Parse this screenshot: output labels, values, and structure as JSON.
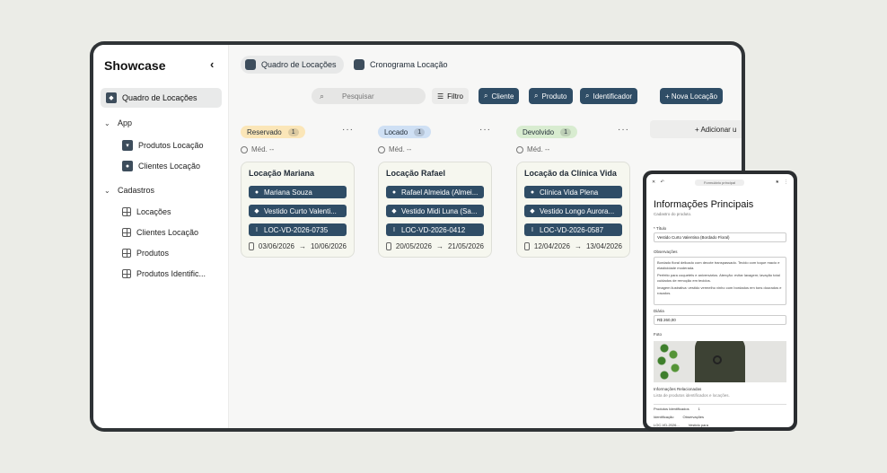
{
  "sidebar": {
    "title": "Showcase",
    "active_item": "Quadro de Locações",
    "groups": [
      {
        "label": "App",
        "items": [
          "Produtos Locação",
          "Clientes Locação"
        ]
      },
      {
        "label": "Cadastros",
        "items": [
          "Locações",
          "Clientes Locação",
          "Produtos",
          "Produtos Identific..."
        ]
      }
    ]
  },
  "tabs": [
    "Quadro de Locações",
    "Cronograma Locação"
  ],
  "toolbar": {
    "search_placeholder": "Pesquisar",
    "filter": "Filtro",
    "chips": [
      "Cliente",
      "Produto",
      "Identificador"
    ],
    "new": "+ Nova Locação"
  },
  "columns": [
    {
      "label": "Reservado",
      "count": "1",
      "color": "#fbe6b8",
      "med": "Méd. --",
      "card": {
        "title": "Locação Mariana",
        "client": "Mariana Souza",
        "product": "Vestido Curto Valenti...",
        "code": "LOC-VD-2026-0735",
        "start": "03/06/2026",
        "end": "10/06/2026"
      }
    },
    {
      "label": "Locado",
      "count": "1",
      "color": "#cfe0f4",
      "med": "Méd. --",
      "card": {
        "title": "Locação Rafael",
        "client": "Rafael Almeida (Almei...",
        "product": "Vestido Midi Luna (Sa...",
        "code": "LOC-VD-2026-0412",
        "start": "20/05/2026",
        "end": "21/05/2026"
      }
    },
    {
      "label": "Devolvido",
      "count": "1",
      "color": "#d8ecd0",
      "med": "Méd. --",
      "card": {
        "title": "Locação da Clínica Vida",
        "client": "Clínica Vida Plena",
        "product": "Vestido Longo Aurora...",
        "code": "LOC-VD-2026-0587",
        "start": "12/04/2026",
        "end": "13/04/2026"
      }
    }
  ],
  "add_column": "+ Adicionar u",
  "tablet": {
    "url": "Formulário principal",
    "title": "Informações Principais",
    "subtitle": "Cadastro do produto.",
    "name_label": "* Título",
    "name_value": "Vestido Curto Valentina (Bordado Floral)",
    "obs_label": "Observações",
    "obs_lines": [
      "Bordado floral delicado com decote transpassado. Tecido com toque macio e elasticidade moderada.",
      "Perfeito para coquetéis e aniversários. Atenção: evitar lavagem; lavação total cuidados de remoção em tecidos.",
      "Imagem ilustrativa: vestido vermelho vinho com bordados em tons dourados e rosados."
    ],
    "price_label": "Diária",
    "price_value": "R$ 260,00",
    "photo_label": "Foto",
    "related_label": "Informações Relacionadas",
    "related_sub": "Lista de produtos identificados e locações.",
    "table_title": "Produtos Identificados",
    "table_count": "1",
    "col1": "Identificação",
    "col2": "Observações",
    "row_code": "LOC-VD-2026...",
    "row_obs": "Vestido para"
  }
}
